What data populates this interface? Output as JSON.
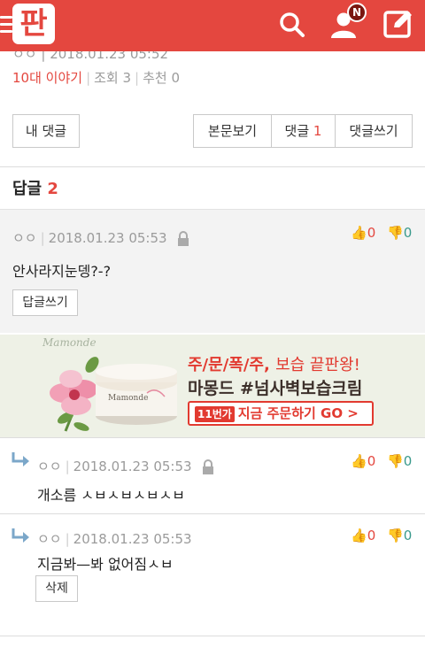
{
  "header": {
    "logo_text": "판",
    "notification_badge": "N"
  },
  "post": {
    "top_meta": "ㅇㅇ | 2018.01.23 05:52",
    "category": "10대 이야기",
    "views": "조회 3",
    "recommends": "추천 0"
  },
  "actions": {
    "my_comments": "내 댓글",
    "view_body": "본문보기",
    "comments_label": "댓글",
    "comments_count": "1",
    "write_comment": "댓글쓰기"
  },
  "replies": {
    "title": "답글",
    "count": "2"
  },
  "comment": {
    "author": "ㅇㅇ",
    "date": "2018.01.23 05:53",
    "text": "안사라지눈뎅?-?",
    "reply_button": "답글쓰기",
    "up": "0",
    "down": "0"
  },
  "ad": {
    "brand": "Mamonde",
    "line1_red": "주/문/폭/주,",
    "line1_rest": "보습 끝판왕!",
    "line2": "마몽드 #넘사벽보습크림",
    "tag": "11번가",
    "cta": "지금 주문하기 GO >"
  },
  "reply1": {
    "author": "ㅇㅇ",
    "date": "2018.01.23 05:53",
    "text": "개소름 ㅅㅂㅅㅂㅅㅂㅅㅂ",
    "up": "0",
    "down": "0"
  },
  "reply2": {
    "author": "ㅇㅇ",
    "date": "2018.01.23 05:53",
    "text": "지금봐—봐 없어짐ㅅㅂ",
    "delete_button": "삭제",
    "up": "0",
    "down": "0"
  },
  "colors": {
    "brand": "#e4473f",
    "vote_down": "#3a9a8c"
  }
}
